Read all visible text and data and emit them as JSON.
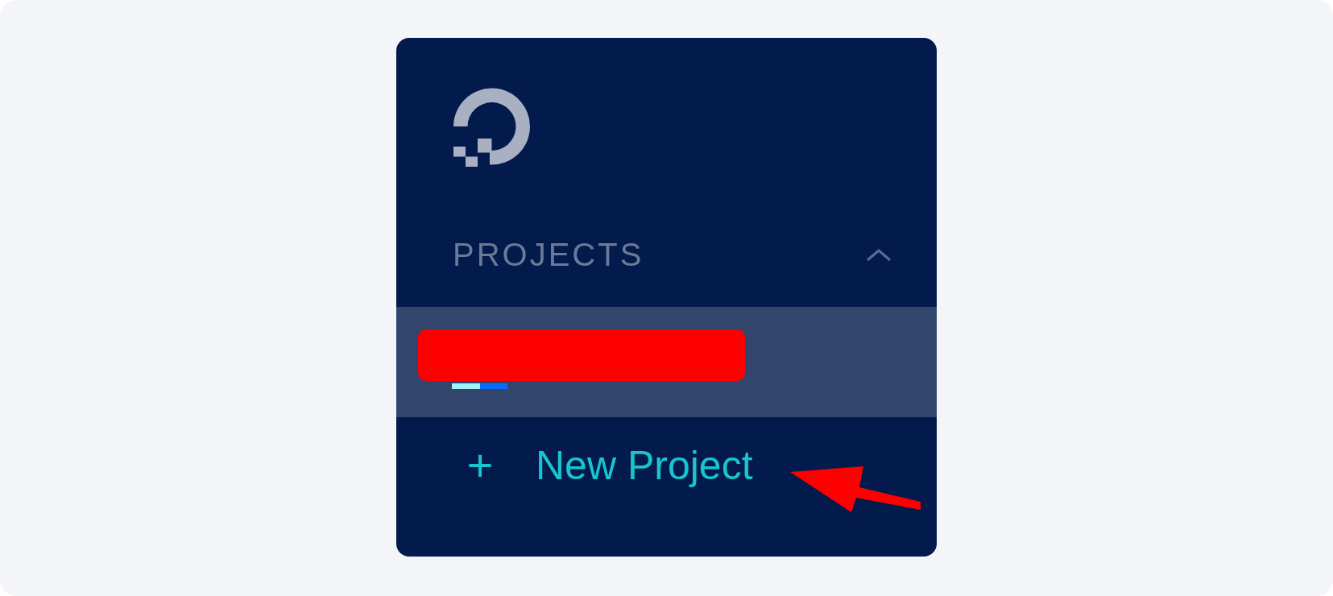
{
  "sidebar": {
    "section": {
      "title": "PROJECTS",
      "expanded": true
    },
    "projects": [
      {
        "selected": true,
        "redacted": true
      }
    ],
    "new_project": {
      "icon": "+",
      "label": "New Project"
    }
  }
}
